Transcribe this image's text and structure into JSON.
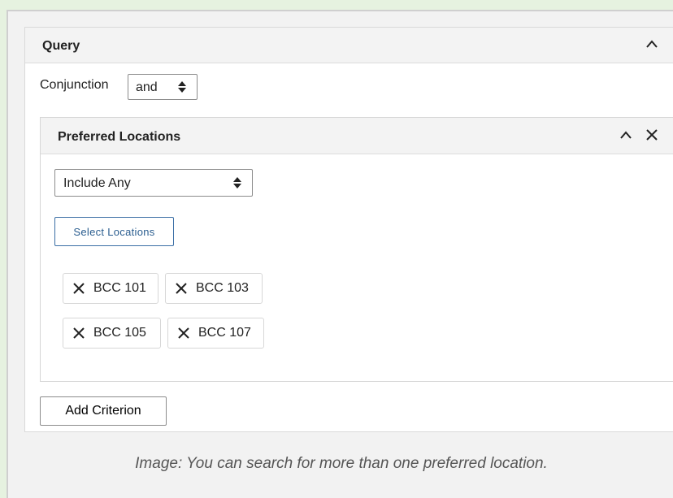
{
  "query": {
    "title": "Query",
    "conjunction_label": "Conjunction",
    "conjunction_value": "and",
    "preferred_locations": {
      "title": "Preferred Locations",
      "include_value": "Include Any",
      "select_button": "Select Locations",
      "chips": [
        "BCC 101",
        "BCC 103",
        "BCC 105",
        "BCC 107"
      ]
    },
    "add_criterion": "Add Criterion"
  },
  "caption": "Image: You can search for more than one preferred location."
}
